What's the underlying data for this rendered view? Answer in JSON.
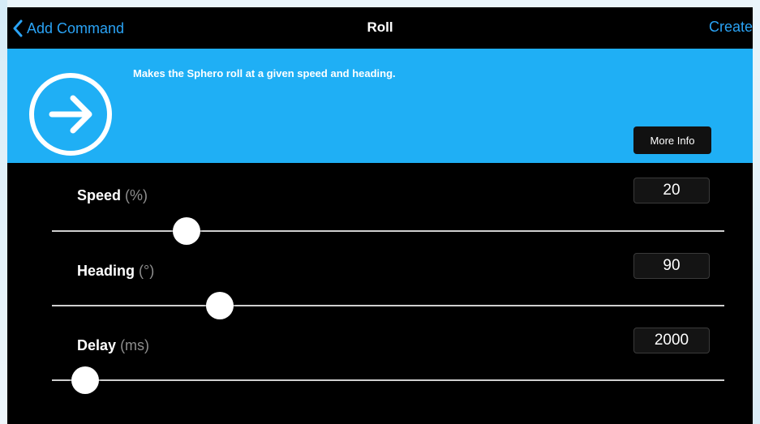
{
  "nav": {
    "back_label": "Add Command",
    "title": "Roll",
    "create_label": "Create"
  },
  "banner": {
    "description": "Makes the Sphero roll at a given speed and heading.",
    "more_info_label": "More Info",
    "icon": "arrow-right-circle-icon"
  },
  "params": [
    {
      "label": "Speed",
      "unit": "(%)",
      "value": "20",
      "slider_fraction": 0.2
    },
    {
      "label": "Heading",
      "unit": "(°)",
      "value": "90",
      "slider_fraction": 0.25
    },
    {
      "label": "Delay",
      "unit": "(ms)",
      "value": "2000",
      "slider_fraction": 0.05
    }
  ],
  "colors": {
    "accent": "#2aa3f5",
    "banner": "#1faff5",
    "background": "#000000"
  }
}
